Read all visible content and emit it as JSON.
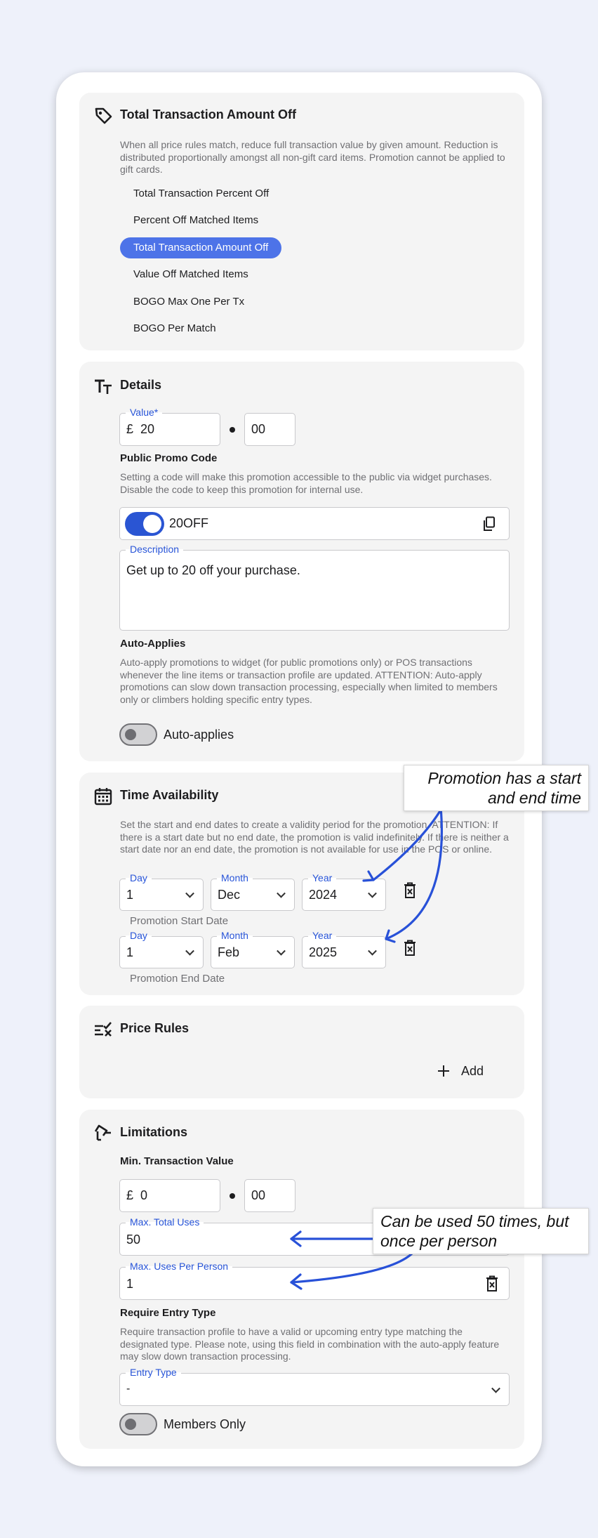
{
  "promotion_type": {
    "title": "Total Transaction Amount Off",
    "icon": "tag-icon",
    "description": "When all price rules match, reduce full transaction value by given amount. Reduction is distributed proportionally amongst all non-gift card items. Promotion cannot be applied to gift cards.",
    "options": [
      {
        "label": "Total Transaction Percent Off",
        "selected": false
      },
      {
        "label": "Percent Off Matched Items",
        "selected": false
      },
      {
        "label": "Total Transaction Amount Off",
        "selected": true
      },
      {
        "label": "Value Off Matched Items",
        "selected": false
      },
      {
        "label": "BOGO Max One Per Tx",
        "selected": false
      },
      {
        "label": "BOGO Per Match",
        "selected": false
      }
    ],
    "accent_color": "#4d73e8"
  },
  "details": {
    "title": "Details",
    "icon": "text-size-icon",
    "value_label": "Value*",
    "currency": "£",
    "value_whole": "20",
    "value_cents": "00",
    "promo_code_heading": "Public Promo Code",
    "promo_code_help": "Setting a code will make this promotion accessible to the public via widget purchases. Disable the code to keep this promotion for internal use.",
    "promo_code_enabled": true,
    "promo_code_value": "20OFF",
    "description_label": "Description",
    "description_value": "Get up to 20 off your purchase.",
    "auto_applies_heading": "Auto-Applies",
    "auto_applies_help": "Auto-apply promotions to widget (for public promotions only) or POS transactions whenever the line items or transaction profile are updated. ATTENTION: Auto-apply promotions can slow down transaction processing, especially when limited to members only or climbers holding specific entry types.",
    "auto_applies_enabled": false,
    "auto_applies_label": "Auto-applies"
  },
  "time": {
    "title": "Time Availability",
    "icon": "calendar-icon",
    "help": "Set the start and end dates to create a validity period for the promotion. ATTENTION: If there is a start date but no end date, the promotion is valid indefinitely. If there is neither a start date nor an end date, the promotion is not available for use in the POS or online.",
    "day_label": "Day",
    "month_label": "Month",
    "year_label": "Year",
    "start": {
      "day": "1",
      "month": "Dec",
      "year": "2024",
      "caption": "Promotion Start Date"
    },
    "end": {
      "day": "1",
      "month": "Feb",
      "year": "2025",
      "caption": "Promotion End Date"
    }
  },
  "price_rules": {
    "title": "Price Rules",
    "icon": "rules-icon",
    "add_label": "Add"
  },
  "limitations": {
    "title": "Limitations",
    "icon": "limit-icon",
    "min_value_heading": "Min. Transaction Value",
    "currency": "£",
    "min_whole": "0",
    "min_cents": "00",
    "max_total_label": "Max. Total Uses",
    "max_total_value": "50",
    "max_person_label": "Max. Uses Per Person",
    "max_person_value": "1",
    "entry_heading": "Require Entry Type",
    "entry_help": "Require transaction profile to have a valid or upcoming entry type matching the designated type. Please note, using this field in combination with the auto-apply feature may slow down transaction processing.",
    "entry_label": "Entry Type",
    "entry_value": "-",
    "members_only_enabled": false,
    "members_only_label": "Members Only"
  },
  "annotations": {
    "time_callout": "Promotion has a start and end time",
    "uses_callout": "Can be used 50 times, but once per person",
    "arrow_color": "#2851d8"
  }
}
